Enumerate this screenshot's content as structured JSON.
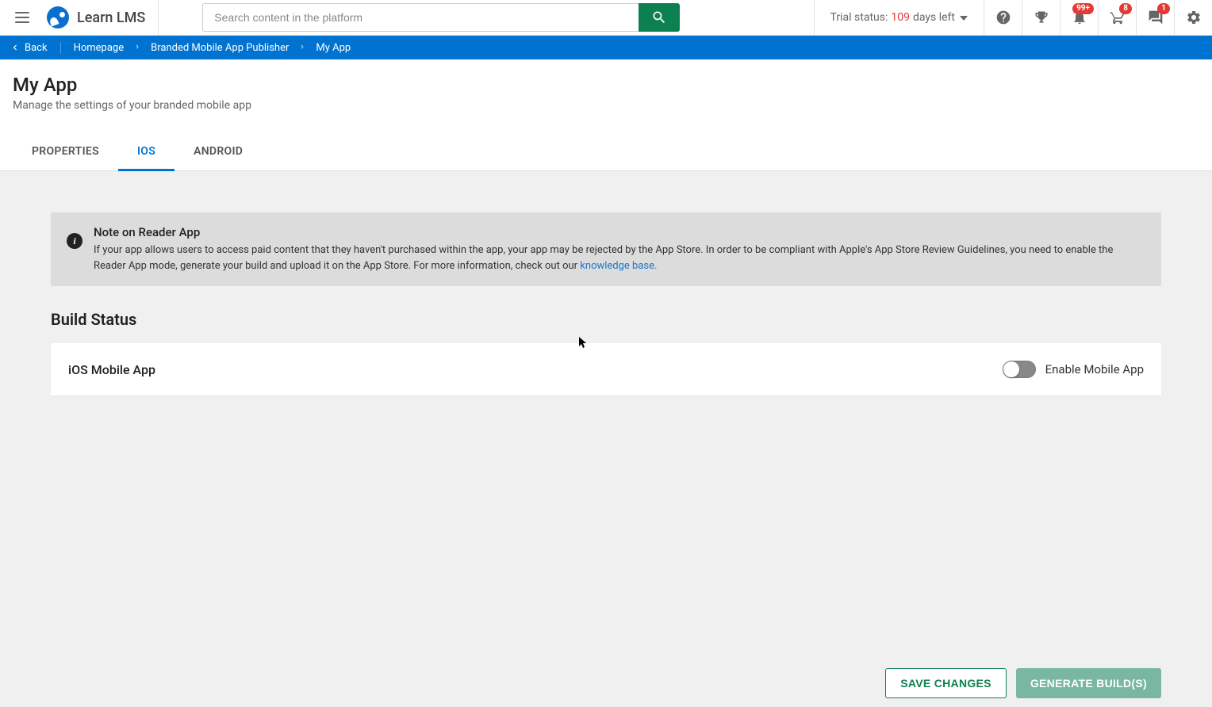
{
  "header": {
    "logo_text": "Learn LMS",
    "search_placeholder": "Search content in the platform",
    "trial_prefix": "Trial status:",
    "trial_days": "109",
    "trial_suffix": "days left",
    "badges": {
      "notifications": "99+",
      "cart": "8",
      "messages": "1"
    }
  },
  "breadcrumb": {
    "back": "Back",
    "items": [
      "Homepage",
      "Branded Mobile App Publisher",
      "My App"
    ]
  },
  "page": {
    "title": "My App",
    "subtitle": "Manage the settings of your branded mobile app"
  },
  "tabs": {
    "properties": "PROPERTIES",
    "ios": "IOS",
    "android": "ANDROID"
  },
  "note": {
    "title": "Note on Reader App",
    "body": "If your app allows users to access paid content that they haven't purchased within the app, your app may be rejected by the App Store. In order to be compliant with Apple's App Store Review Guidelines, you need to enable the Reader App mode, generate your build and upload it on the App Store. For more information, check out our ",
    "link": "knowledge base."
  },
  "build": {
    "section_title": "Build Status",
    "label": "iOS Mobile App",
    "toggle_label": "Enable Mobile App"
  },
  "footer": {
    "save": "SAVE CHANGES",
    "generate": "GENERATE BUILD(S)"
  }
}
